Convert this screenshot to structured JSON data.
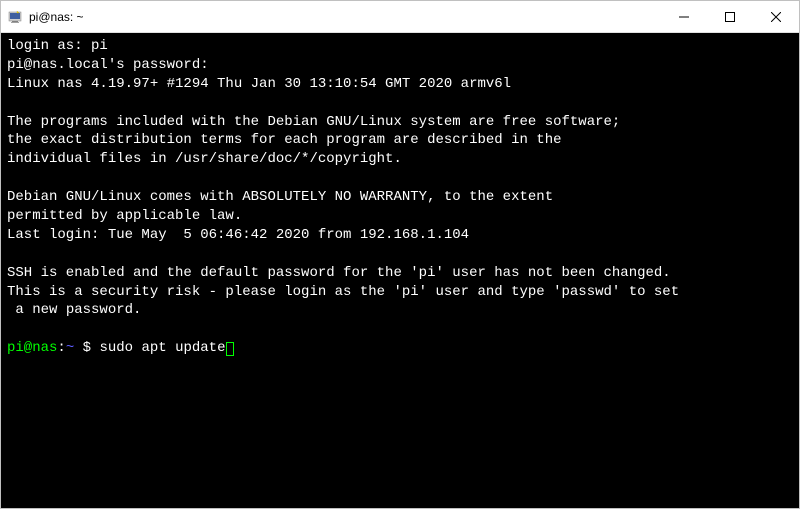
{
  "titlebar": {
    "title": "pi@nas: ~"
  },
  "terminal": {
    "login_prompt": "login as: ",
    "login_user": "pi",
    "password_prompt": "pi@nas.local's password:",
    "kernel_line": "Linux nas 4.19.97+ #1294 Thu Jan 30 13:10:54 GMT 2020 armv6l",
    "motd_line1": "The programs included with the Debian GNU/Linux system are free software;",
    "motd_line2": "the exact distribution terms for each program are described in the",
    "motd_line3": "individual files in /usr/share/doc/*/copyright.",
    "warranty_line1": "Debian GNU/Linux comes with ABSOLUTELY NO WARRANTY, to the extent",
    "warranty_line2": "permitted by applicable law.",
    "last_login": "Last login: Tue May  5 06:46:42 2020 from 192.168.1.104",
    "ssh_warning_line1": "SSH is enabled and the default password for the 'pi' user has not been changed.",
    "ssh_warning_line2": "This is a security risk - please login as the 'pi' user and type 'passwd' to set",
    "ssh_warning_line3": " a new password.",
    "prompt_user_host": "pi@nas",
    "prompt_colon": ":",
    "prompt_path": "~",
    "prompt_symbol": " $ ",
    "command": "sudo apt update"
  }
}
